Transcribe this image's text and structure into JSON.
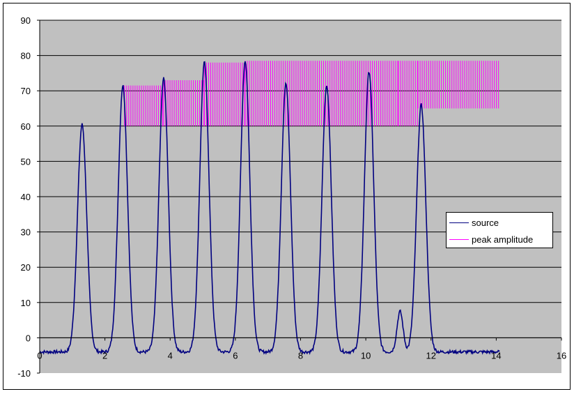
{
  "chart_data": {
    "type": "line",
    "title": "",
    "xlabel": "",
    "ylabel": "",
    "xlim": [
      0,
      16
    ],
    "ylim": [
      -10,
      90
    ],
    "x_ticks": [
      0,
      2,
      4,
      6,
      8,
      10,
      12,
      14,
      16
    ],
    "y_ticks": [
      -10,
      0,
      10,
      20,
      30,
      40,
      50,
      60,
      70,
      80,
      90
    ],
    "grid": "horizontal",
    "legend_position": "right",
    "plot_background": "#c0c0c0",
    "series": [
      {
        "name": "source",
        "color": "#000080",
        "baseline": -4,
        "peaks": [
          {
            "x": 1.3,
            "y": 60.5
          },
          {
            "x": 2.55,
            "y": 71.5
          },
          {
            "x": 3.8,
            "y": 73.5
          },
          {
            "x": 5.05,
            "y": 78
          },
          {
            "x": 6.3,
            "y": 78.5
          },
          {
            "x": 7.55,
            "y": 72
          },
          {
            "x": 8.8,
            "y": 71.5
          },
          {
            "x": 10.1,
            "y": 75.5
          },
          {
            "x": 11.05,
            "y": 7.5
          },
          {
            "x": 11.7,
            "y": 66
          }
        ],
        "x_range": [
          0,
          14.1
        ]
      },
      {
        "name": "peak amplitude",
        "color": "#ff00ff",
        "type": "vertical-ranges",
        "segments": [
          {
            "x_start": 2.6,
            "x_end": 3.8,
            "low": 60,
            "high": 71.5
          },
          {
            "x_start": 3.8,
            "x_end": 5.05,
            "low": 60,
            "high": 73
          },
          {
            "x_start": 5.05,
            "x_end": 6.3,
            "low": 60,
            "high": 78
          },
          {
            "x_start": 6.3,
            "x_end": 11.0,
            "low": 60,
            "high": 78.5
          },
          {
            "x_start": 11.0,
            "x_end": 11.6,
            "low": 60,
            "high": 78.5
          },
          {
            "x_start": 11.6,
            "x_end": 14.1,
            "low": 65,
            "high": 78.5
          }
        ]
      }
    ]
  }
}
